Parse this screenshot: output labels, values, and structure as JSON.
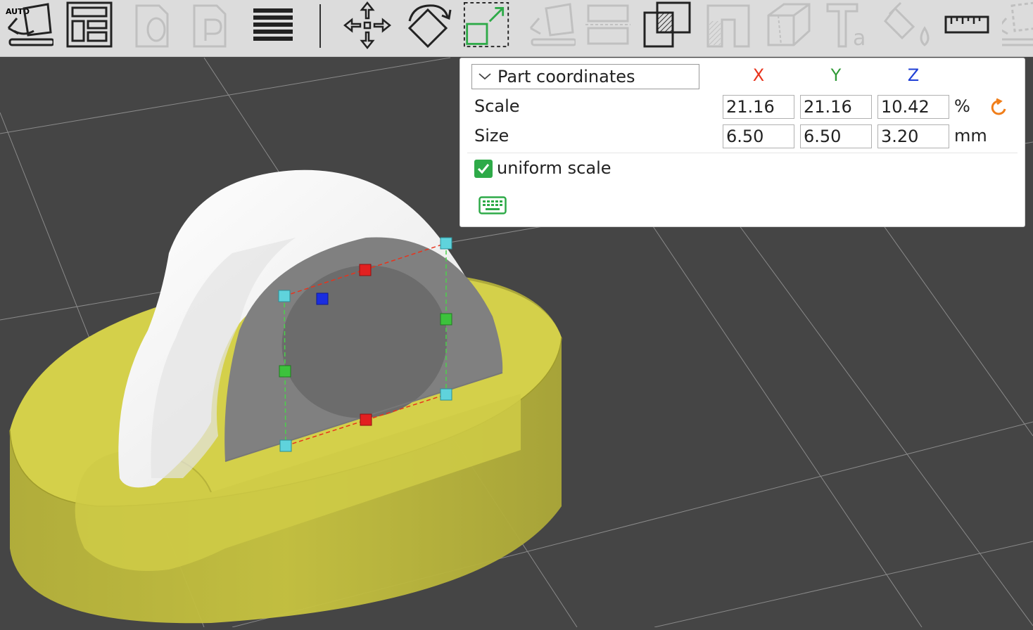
{
  "toolbar": {
    "auto_label": "AUTO",
    "items": [
      {
        "name": "auto-orient-icon",
        "enabled": true
      },
      {
        "name": "arrange-icon",
        "enabled": true
      },
      {
        "name": "orient-icon",
        "enabled": false
      },
      {
        "name": "place-icon",
        "enabled": false
      },
      {
        "name": "layers-icon",
        "enabled": true
      },
      {
        "name": "move-icon",
        "enabled": true
      },
      {
        "name": "rotate-icon",
        "enabled": true
      },
      {
        "name": "scale-icon",
        "enabled": true,
        "active": true
      },
      {
        "name": "lay-on-face-icon",
        "enabled": false
      },
      {
        "name": "cut-icon",
        "enabled": false
      },
      {
        "name": "boolean-icon",
        "enabled": true
      },
      {
        "name": "support-paint-icon",
        "enabled": false
      },
      {
        "name": "seam-paint-icon",
        "enabled": false
      },
      {
        "name": "text-icon",
        "enabled": false
      },
      {
        "name": "color-paint-icon",
        "enabled": false
      },
      {
        "name": "measure-icon",
        "enabled": true
      },
      {
        "name": "assembly-icon",
        "enabled": false
      }
    ]
  },
  "panel": {
    "coordinate_system": "Part coordinates",
    "axes": {
      "x": "X",
      "y": "Y",
      "z": "Z"
    },
    "axis_colors": {
      "x": "#e8331c",
      "y": "#2f9a36",
      "z": "#1f3fd6"
    },
    "scale": {
      "label": "Scale",
      "x": "21.16",
      "y": "21.16",
      "z": "10.42",
      "unit": "%"
    },
    "size": {
      "label": "Size",
      "x": "6.50",
      "y": "6.50",
      "z": "3.20",
      "unit": "mm"
    },
    "uniform_scale": {
      "label": "uniform scale",
      "checked": true
    },
    "accent_color": "#2eaa48",
    "reset_color": "#f07e1a"
  }
}
